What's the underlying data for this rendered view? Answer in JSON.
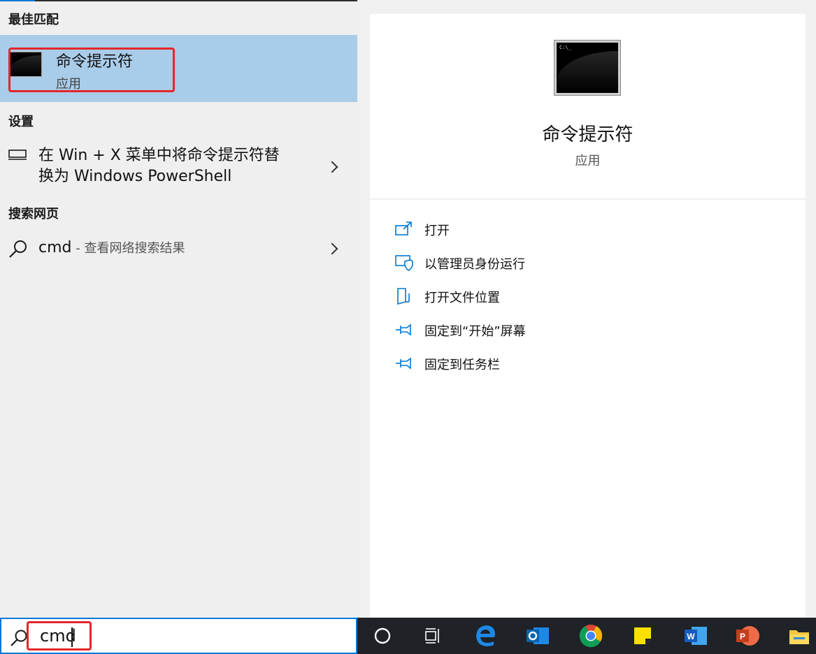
{
  "sections": {
    "best_match": "最佳匹配",
    "settings": "设置",
    "web_search": "搜索网页"
  },
  "best_match_item": {
    "name": "命令提示符",
    "type": "应用",
    "icon": "cmd-icon"
  },
  "settings_item": {
    "line1": "在 Win + X 菜单中将命令提示符替",
    "line2": "换为 Windows PowerShell",
    "icon": "laptop-icon"
  },
  "web_item": {
    "query": "cmd",
    "suffix": " - 查看网络搜索结果",
    "icon": "search-icon"
  },
  "detail": {
    "title": "命令提示符",
    "subtitle": "应用",
    "prompt_text": "C:\\_"
  },
  "actions": [
    {
      "label": "打开",
      "icon": "open-icon"
    },
    {
      "label": "以管理员身份运行",
      "icon": "shield-icon"
    },
    {
      "label": "打开文件位置",
      "icon": "file-location-icon"
    },
    {
      "label": "固定到“开始”屏幕",
      "icon": "pin-icon"
    },
    {
      "label": "固定到任务栏",
      "icon": "pin-icon"
    }
  ],
  "search": {
    "value": "cmd"
  },
  "taskbar": [
    {
      "name": "cortana-icon"
    },
    {
      "name": "task-view-icon"
    },
    {
      "name": "edge-icon"
    },
    {
      "name": "outlook-icon"
    },
    {
      "name": "chrome-icon"
    },
    {
      "name": "sticky-notes-icon"
    },
    {
      "name": "word-icon"
    },
    {
      "name": "powerpoint-icon"
    },
    {
      "name": "file-explorer-icon"
    }
  ],
  "colors": {
    "accent": "#0078d7",
    "highlight": "#a9cce9",
    "annotation_red": "#e4262a",
    "taskbar": "#1f2227"
  }
}
